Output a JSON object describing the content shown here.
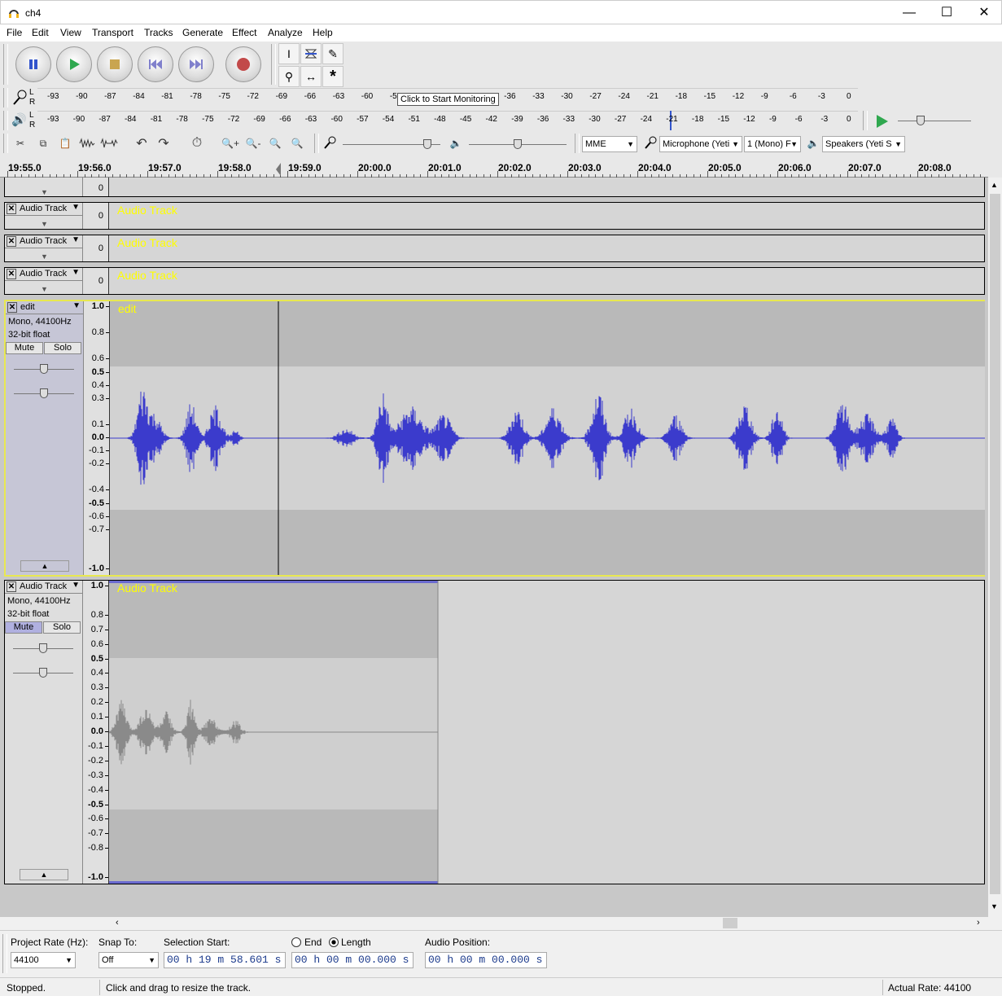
{
  "window": {
    "title": "ch4"
  },
  "menu": [
    "File",
    "Edit",
    "View",
    "Transport",
    "Tracks",
    "Generate",
    "Effect",
    "Analyze",
    "Help"
  ],
  "meters": {
    "record_scale": [
      "-93",
      "-90",
      "-87",
      "-84",
      "-81",
      "-78",
      "-75",
      "-72",
      "-69",
      "-66",
      "-63",
      "-60",
      "-57",
      "-5",
      "-42",
      "-39",
      "-36",
      "-33",
      "-30",
      "-27",
      "-24",
      "-21",
      "-18",
      "-15",
      "-12",
      "-9",
      "-6",
      "-3",
      "0"
    ],
    "playback_scale": [
      "-93",
      "-90",
      "-87",
      "-84",
      "-81",
      "-78",
      "-75",
      "-72",
      "-69",
      "-66",
      "-63",
      "-60",
      "-57",
      "-54",
      "-51",
      "-48",
      "-45",
      "-42",
      "-39",
      "-36",
      "-33",
      "-30",
      "-27",
      "-24",
      "-21",
      "-18",
      "-15",
      "-12",
      "-9",
      "-6",
      "-3",
      "0"
    ],
    "monitor_tooltip": "Click to Start Monitoring",
    "lr_top": "L",
    "lr_bottom": "R"
  },
  "device": {
    "host": "MME",
    "mic": "Microphone (Yeti",
    "channels": "1 (Mono) F",
    "speakers": "Speakers (Yeti S"
  },
  "ruler": [
    "19:55.0",
    "19:56.0",
    "19:57.0",
    "19:58.0",
    "19:59.0",
    "20:00.0",
    "20:01.0",
    "20:02.0",
    "20:03.0",
    "20:04.0",
    "20:05.0",
    "20:06.0",
    "20:07.0",
    "20:08.0"
  ],
  "tracks": {
    "collapsed": [
      {
        "name": "Audio Track",
        "value": "0",
        "label": "Audio Track"
      },
      {
        "name": "Audio Track",
        "value": "0",
        "label": "Audio Track"
      },
      {
        "name": "Audio Track",
        "value": "0",
        "label": "Audio Track"
      }
    ],
    "edit": {
      "name": "edit",
      "format": "Mono, 44100Hz",
      "bits": "32-bit float",
      "label": "edit",
      "mute": "Mute",
      "solo": "Solo",
      "scale": [
        "1.0",
        "0.8",
        "0.6",
        "0.5",
        "0.4",
        "0.3",
        "0.1",
        "0.0",
        "-0.1",
        "-0.2",
        "-0.4",
        "-0.5",
        "-0.6",
        "-0.7",
        "-1.0"
      ]
    },
    "audio": {
      "name": "Audio Track",
      "format": "Mono, 44100Hz",
      "bits": "32-bit float",
      "label": "Audio Track",
      "mute": "Mute",
      "solo": "Solo",
      "scale": [
        "1.0",
        "0.8",
        "0.7",
        "0.6",
        "0.5",
        "0.4",
        "0.3",
        "0.2",
        "0.1",
        "0.0",
        "-0.1",
        "-0.2",
        "-0.3",
        "-0.4",
        "-0.5",
        "-0.6",
        "-0.7",
        "-0.8",
        "-1.0"
      ]
    }
  },
  "selection": {
    "rate_label": "Project Rate (Hz):",
    "rate_value": "44100",
    "snap_label": "Snap To:",
    "snap_value": "Off",
    "start_label": "Selection Start:",
    "start_value": "00 h 19 m 58.601 s",
    "end_label": "End",
    "length_label": "Length",
    "length_value": "00 h 00 m 00.000 s",
    "position_label": "Audio Position:",
    "position_value": "00 h 00 m 00.000 s"
  },
  "status": {
    "state": "Stopped.",
    "hint": "Click and drag to resize the track.",
    "rate": "Actual Rate: 44100"
  },
  "colors": {
    "wave_selected": "#3b3bcc",
    "wave_muted": "#8a8a8a",
    "label": "#ffff00"
  }
}
